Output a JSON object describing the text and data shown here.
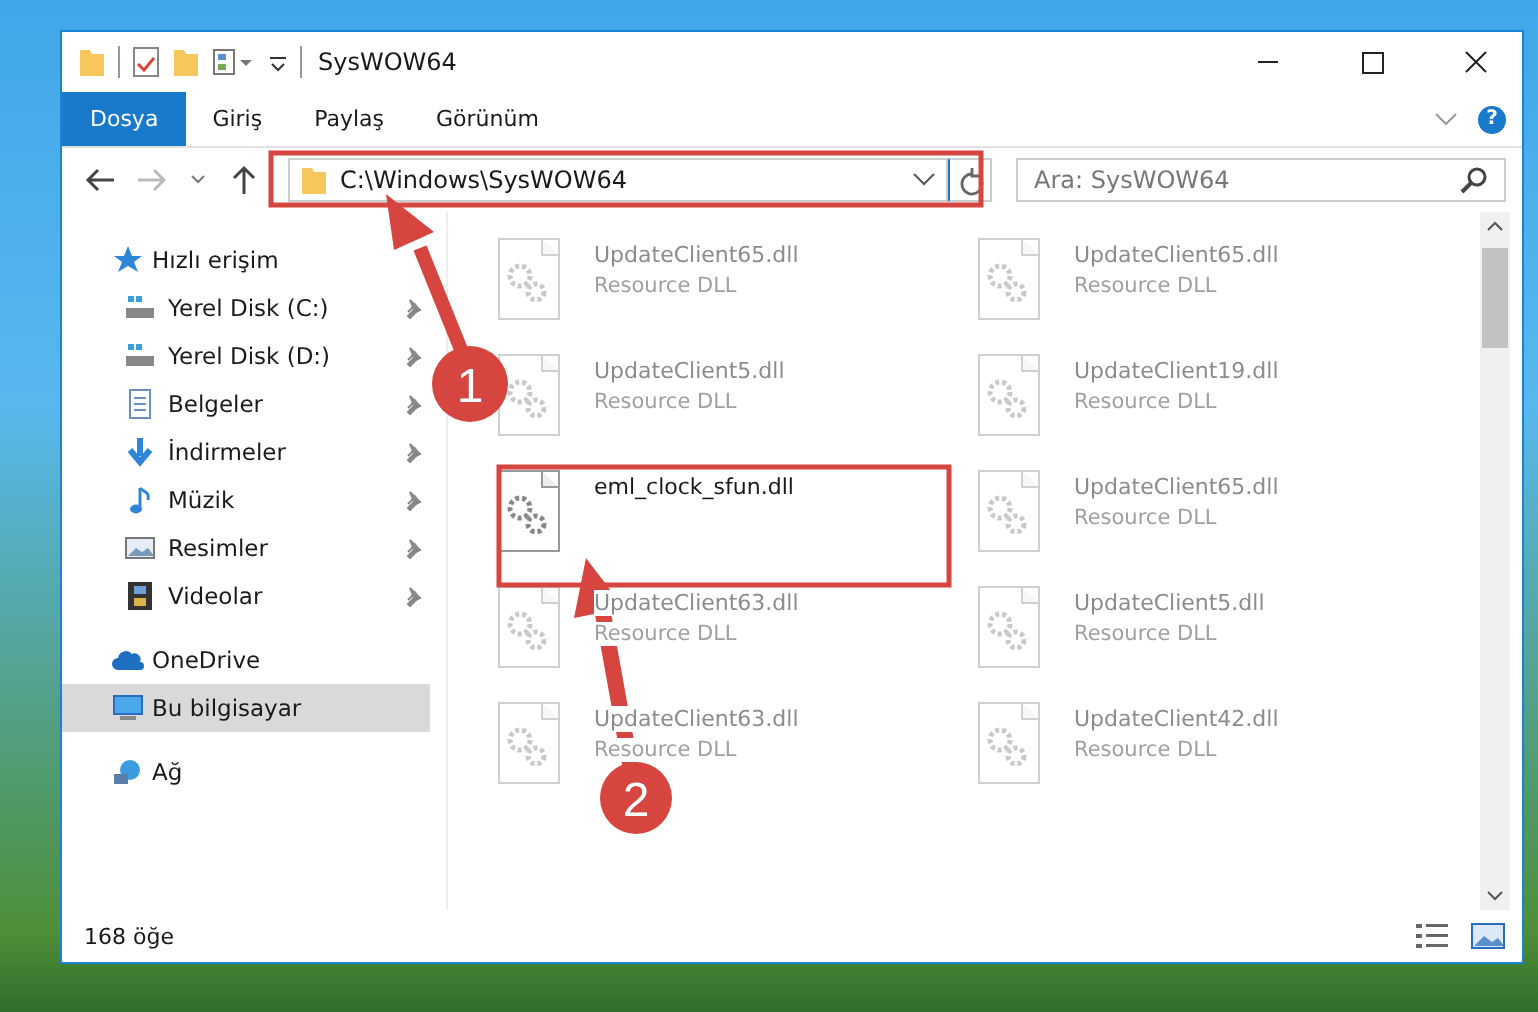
{
  "window": {
    "title": "SysWOW64",
    "help_label": "?"
  },
  "ribbon_tabs": [
    {
      "label": "Dosya",
      "selected": true
    },
    {
      "label": "Giriş",
      "selected": false
    },
    {
      "label": "Paylaş",
      "selected": false
    },
    {
      "label": "Görünüm",
      "selected": false
    }
  ],
  "address_bar": {
    "value": "C:\\Windows\\SysWOW64"
  },
  "search": {
    "placeholder": "Ara: SysWOW64"
  },
  "sidebar": {
    "items": [
      {
        "label": "Hızlı erişim",
        "kind": "star",
        "selected": false,
        "children": [
          {
            "label": "Yerel Disk (C:)",
            "kind": "drive",
            "pinned": true,
            "selected": false
          },
          {
            "label": "Yerel Disk (D:)",
            "kind": "drive",
            "pinned": true,
            "selected": false
          },
          {
            "label": "Belgeler",
            "kind": "docs",
            "pinned": true,
            "selected": false
          },
          {
            "label": "İndirmeler",
            "kind": "download",
            "pinned": true,
            "selected": false
          },
          {
            "label": "Müzik",
            "kind": "music",
            "pinned": true,
            "selected": false
          },
          {
            "label": "Resimler",
            "kind": "pictures",
            "pinned": true,
            "selected": false
          },
          {
            "label": "Videolar",
            "kind": "videos",
            "pinned": true,
            "selected": false
          }
        ]
      },
      {
        "label": "OneDrive",
        "kind": "cloud",
        "selected": false
      },
      {
        "label": "Bu bilgisayar",
        "kind": "computer",
        "selected": true
      },
      {
        "label": "Ağ",
        "kind": "network",
        "selected": false
      }
    ]
  },
  "files": [
    {
      "name": "UpdateClient65.dll",
      "type": "Resource DLL",
      "faded": true
    },
    {
      "name": "UpdateClient65.dll",
      "type": "Resource DLL",
      "faded": true
    },
    {
      "name": "UpdateClient5.dll",
      "type": "Resource DLL",
      "faded": true
    },
    {
      "name": "UpdateClient19.dll",
      "type": "Resource DLL",
      "faded": true
    },
    {
      "name": "eml_clock_sfun.dll",
      "faded": false
    },
    {
      "name": "UpdateClient65.dll",
      "type": "Resource DLL",
      "faded": true
    },
    {
      "name": "UpdateClient63.dll",
      "type": "Resource DLL",
      "faded": true
    },
    {
      "name": "UpdateClient5.dll",
      "type": "Resource DLL",
      "faded": true
    },
    {
      "name": "UpdateClient63.dll",
      "type": "Resource DLL",
      "faded": true
    },
    {
      "name": "UpdateClient42.dll",
      "type": "Resource DLL",
      "faded": true
    }
  ],
  "status_bar": {
    "item_count": "168 öğe"
  },
  "annotations": [
    {
      "number": "1"
    },
    {
      "number": "2"
    }
  ]
}
